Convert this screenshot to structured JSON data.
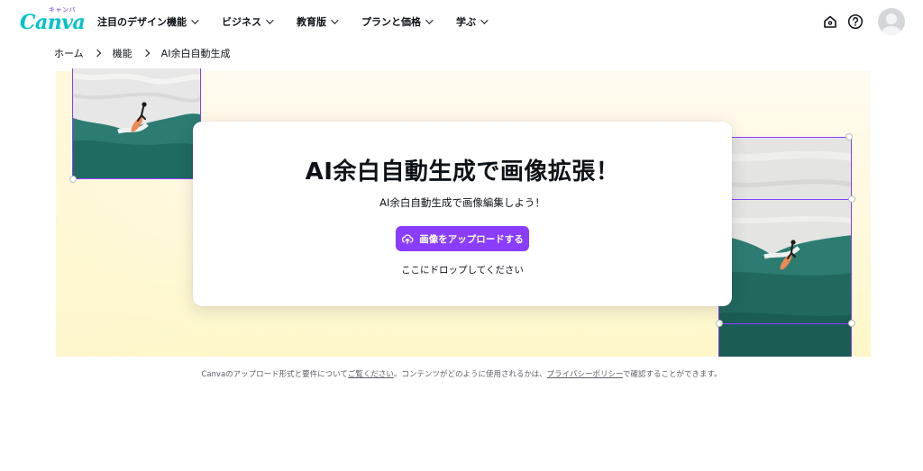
{
  "header": {
    "logo_kana": "キャンバ",
    "logo_word": "Canva",
    "nav": [
      {
        "label": "注目のデザイン機能"
      },
      {
        "label": "ビジネス"
      },
      {
        "label": "教育版"
      },
      {
        "label": "プランと価格"
      },
      {
        "label": "学ぶ"
      }
    ],
    "icons": {
      "home": "home-icon",
      "help": "help-icon",
      "avatar": "avatar"
    }
  },
  "breadcrumb": [
    "ホーム",
    "機能",
    "AI余白自動生成"
  ],
  "hero": {
    "title": "AI余白自動生成で画像拡張！",
    "subtitle": "AI余白自動生成で画像編集しよう！",
    "upload_label": "画像をアップロードする",
    "drop_label": "ここにドロップしてください"
  },
  "note": {
    "part1": "Canvaのアップロード形式と要件について",
    "link1": "ご覧ください",
    "part2": "。コンテンツがどのように使用されるかは、",
    "link2": "プライバシーポリシー",
    "part3": "で確認することができます。"
  },
  "colors": {
    "brand_purple": "#8b3dff",
    "logo_teal": "#00c4cc",
    "hero_bg": "#fff9dd"
  }
}
